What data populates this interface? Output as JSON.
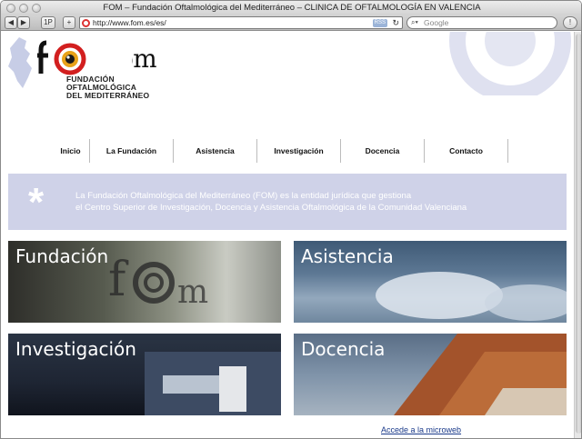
{
  "window": {
    "title": "FOM – Fundación Oftalmológica del Mediterráneo – CLINICA DE OFTALMOLOGÍA EN VALENCIA"
  },
  "toolbar": {
    "back_icon": "back-arrow-icon",
    "forward_icon": "forward-arrow-icon",
    "onep_label": "1P",
    "add_label": "+",
    "url": "http://www.fom.es/es/",
    "rss_label": "RSS",
    "reload_icon": "reload-icon",
    "search_placeholder": "Google",
    "status_icon": "info-icon"
  },
  "logo": {
    "letters": "fom",
    "line1": "FUNDACIÓN",
    "line2": "OFTALMOLÓGICA",
    "line3": "DEL MEDITERRÁNEO"
  },
  "nav": {
    "items": [
      {
        "label": "Inicio"
      },
      {
        "label": "La Fundación"
      },
      {
        "label": "Asistencia"
      },
      {
        "label": "Investigación"
      },
      {
        "label": "Docencia"
      },
      {
        "label": "Contacto"
      }
    ]
  },
  "banner": {
    "symbol": "*",
    "line1": "La Fundación Oftalmológica del Mediterráneo (FOM) es la entidad jurídica que gestiona",
    "line2": "el Centro Superior de Investigación, Docencia y Asistencia Oftalmológica de la Comunidad Valenciana"
  },
  "tiles": [
    {
      "label": "Fundación"
    },
    {
      "label": "Asistencia"
    },
    {
      "label": "Investigación"
    },
    {
      "label": "Docencia"
    }
  ],
  "footer": {
    "link": "Accede a la microweb"
  },
  "colors": {
    "banner": "#cfd2e8",
    "nav_divider": "#bcbcbc",
    "brand_red": "#d21f1f",
    "brand_orange": "#e8a21a"
  }
}
